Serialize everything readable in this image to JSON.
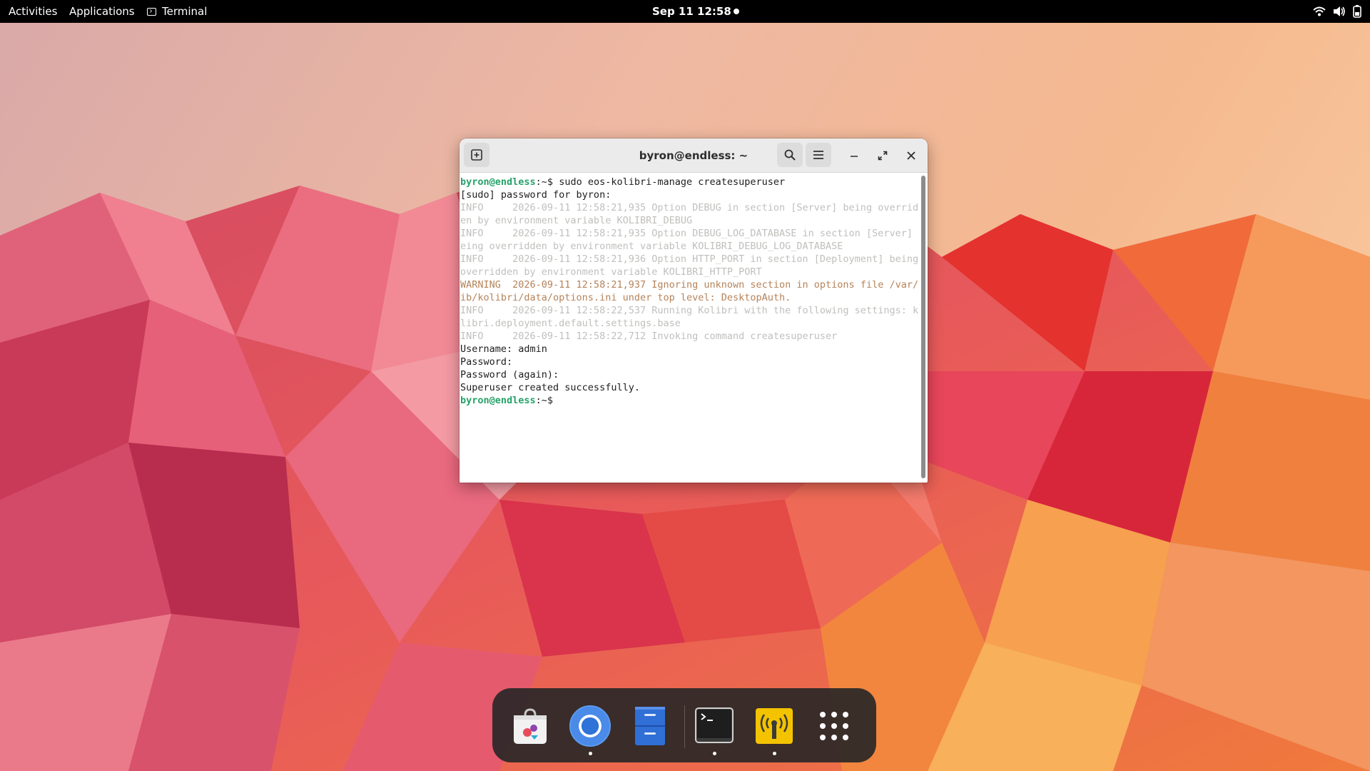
{
  "topbar": {
    "activities": "Activities",
    "applications": "Applications",
    "active_app": "Terminal",
    "clock": "Sep 11  12:58",
    "status_icons": [
      "wifi-icon",
      "volume-icon",
      "battery-icon"
    ]
  },
  "window": {
    "title": "byron@endless: ~",
    "header_buttons": [
      "new-tab-icon",
      "search-icon",
      "hamburger-menu-icon",
      "minimize-icon",
      "maximize-icon",
      "close-icon"
    ]
  },
  "terminal": {
    "prompt": "byron@endless",
    "prompt_suffix": ":~$",
    "lines": [
      {
        "kind": "prompt",
        "text": " sudo eos-kolibri-manage createsuperuser"
      },
      {
        "kind": "normal",
        "text": "[sudo] password for byron:"
      },
      {
        "kind": "info",
        "text": "INFO     2026-09-11 12:58:21,935 Option DEBUG in section [Server] being overridd"
      },
      {
        "kind": "info",
        "text": "en by environment variable KOLIBRI_DEBUG"
      },
      {
        "kind": "info",
        "text": "INFO     2026-09-11 12:58:21,935 Option DEBUG_LOG_DATABASE in section [Server] b"
      },
      {
        "kind": "info",
        "text": "eing overridden by environment variable KOLIBRI_DEBUG_LOG_DATABASE"
      },
      {
        "kind": "info",
        "text": "INFO     2026-09-11 12:58:21,936 Option HTTP_PORT in section [Deployment] being"
      },
      {
        "kind": "info",
        "text": "overridden by environment variable KOLIBRI_HTTP_PORT"
      },
      {
        "kind": "warn",
        "text": "WARNING  2026-09-11 12:58:21,937 Ignoring unknown section in options file /var/l"
      },
      {
        "kind": "warn",
        "text": "ib/kolibri/data/options.ini under top level: DesktopAuth."
      },
      {
        "kind": "info",
        "text": "INFO     2026-09-11 12:58:22,537 Running Kolibri with the following settings: ko"
      },
      {
        "kind": "info",
        "text": "libri.deployment.default.settings.base"
      },
      {
        "kind": "info",
        "text": "INFO     2026-09-11 12:58:22,712 Invoking command createsuperuser"
      },
      {
        "kind": "normal",
        "text": "Username: admin"
      },
      {
        "kind": "normal",
        "text": "Password:"
      },
      {
        "kind": "normal",
        "text": "Password (again):"
      },
      {
        "kind": "normal",
        "text": "Superuser created successfully."
      },
      {
        "kind": "prompt",
        "text": ""
      }
    ]
  },
  "dock": {
    "apps": [
      {
        "icon": "app-center-icon",
        "running": false
      },
      {
        "icon": "chromium-icon",
        "running": true
      },
      {
        "icon": "files-icon",
        "running": false
      },
      {
        "icon": "terminal-icon",
        "running": true
      },
      {
        "icon": "kolibri-server-icon",
        "running": true
      },
      {
        "icon": "app-grid-icon",
        "running": false
      }
    ]
  },
  "colors": {
    "prompt": "#26a269",
    "info": "#c0bfbc",
    "warning": "#b5835a",
    "dock": "#262626"
  }
}
